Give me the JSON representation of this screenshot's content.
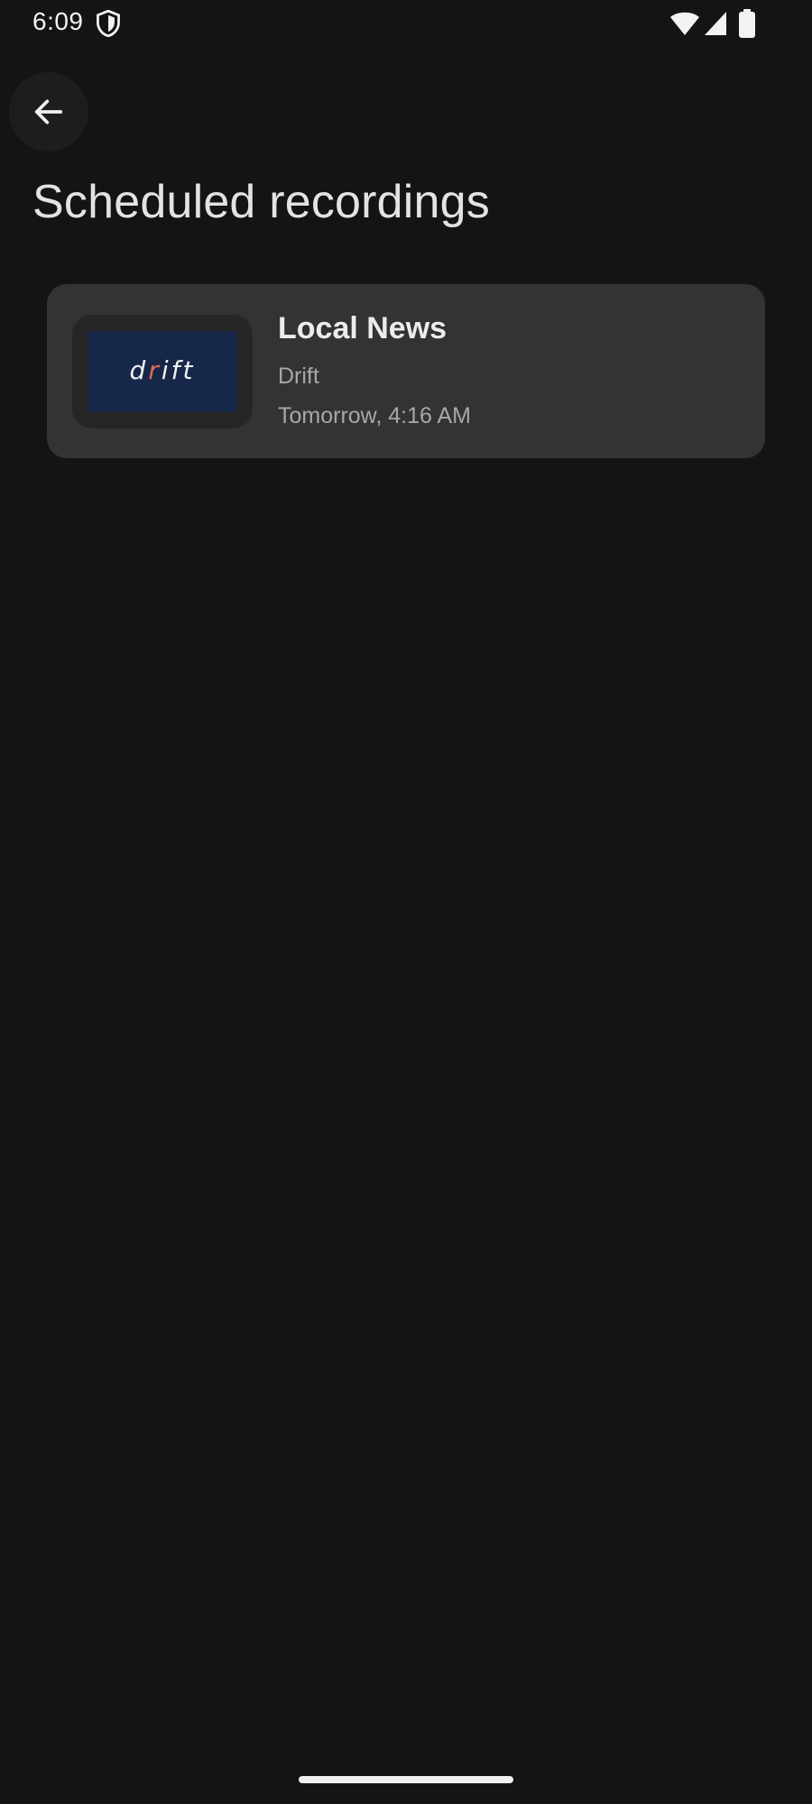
{
  "status_bar": {
    "time": "6:09",
    "icons": [
      "shield-icon",
      "wifi-icon",
      "signal-icon",
      "battery-icon"
    ]
  },
  "header": {
    "back_icon": "arrow-left-icon",
    "title": "Scheduled recordings"
  },
  "recordings": [
    {
      "title": "Local News",
      "channel": "Drift",
      "time": "Tomorrow, 4:16 AM",
      "thumbnail_logo": "drift"
    }
  ],
  "colors": {
    "background": "#141414",
    "card": "#323335",
    "thumbnail_bg": "#17274a",
    "logo_accent": "#e06b5a"
  }
}
